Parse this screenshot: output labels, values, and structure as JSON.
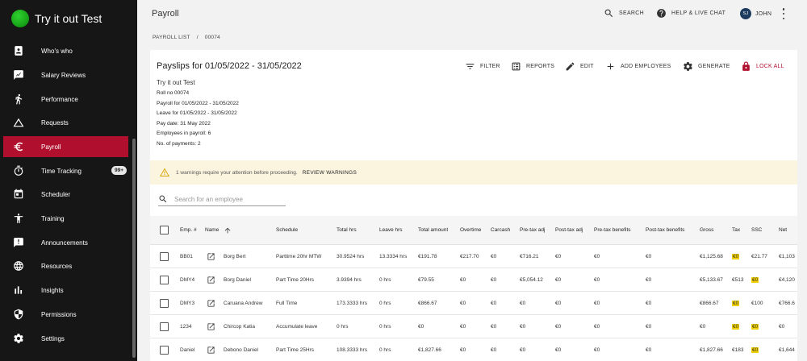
{
  "app": {
    "title": "Try it out Test"
  },
  "sidebar": {
    "items": [
      {
        "label": "Who's who",
        "icon": "id-badge-icon"
      },
      {
        "label": "Salary Reviews",
        "icon": "chart-review-icon"
      },
      {
        "label": "Performance",
        "icon": "running-person-icon"
      },
      {
        "label": "Requests",
        "icon": "triangle-icon"
      },
      {
        "label": "Payroll",
        "icon": "euro-icon",
        "active": true
      },
      {
        "label": "Time Tracking",
        "icon": "stopwatch-icon",
        "badge": "99+"
      },
      {
        "label": "Scheduler",
        "icon": "calendar-icon"
      },
      {
        "label": "Training",
        "icon": "person-arms-icon"
      },
      {
        "label": "Announcements",
        "icon": "announcement-icon"
      },
      {
        "label": "Resources",
        "icon": "globe-icon"
      },
      {
        "label": "Insights",
        "icon": "bar-chart-icon"
      },
      {
        "label": "Permissions",
        "icon": "shield-icon"
      },
      {
        "label": "Settings",
        "icon": "gear-icon"
      }
    ]
  },
  "header": {
    "title": "Payroll",
    "search_label": "SEARCH",
    "help_label": "HELP & LIVE CHAT",
    "user_initials": "SJ",
    "user_name": "JOHN"
  },
  "breadcrumb": {
    "root": "PAYROLL LIST",
    "separator": "/",
    "current": "00074"
  },
  "payslips": {
    "title": "Payslips for 01/05/2022 - 31/05/2022",
    "actions": {
      "filter": "FILTER",
      "reports": "REPORTS",
      "edit": "EDIT",
      "add_employees": "ADD EMPLOYEES",
      "generate": "GENERATE",
      "lock_all": "LOCK ALL"
    },
    "info": {
      "company": "Try it out Test",
      "lines": [
        "Roll no 00074",
        "Payroll for 01/05/2022 - 31/05/2022",
        "Leave for 01/05/2022 - 31/05/2022",
        "Pay date: 31 May 2022",
        "Employees in payroll: 6",
        "No. of payments: 2"
      ]
    },
    "warning": {
      "text": "1 warnings require your attention before proceeding.",
      "link": "REVIEW WARNINGS"
    },
    "search_placeholder": "Search for an employee"
  },
  "table": {
    "columns": [
      "Emp. #",
      "Name",
      "Schedule",
      "Total hrs",
      "Leave hrs",
      "Total amount",
      "Overtime",
      "Carcash",
      "Pre-tax adj",
      "Post-tax adj",
      "Pre-tax benefits",
      "Post-tax benefits",
      "Gross",
      "Tax",
      "SSC",
      "Net"
    ],
    "rows": [
      {
        "emp": "BB01",
        "name": "Borg Bert",
        "schedule": "Parttime 20hr MTW",
        "total_hrs": "30.9524 hrs",
        "leave_hrs": "13.3334 hrs",
        "total_amount": "€191.78",
        "overtime": "€217.70",
        "carcash": "€0",
        "pre_tax_adj": "€716.21",
        "post_tax_adj": "€0",
        "pre_tax_benefits": "€0",
        "post_tax_benefits": "€0",
        "gross": "€1,125.68",
        "tax": "€0",
        "tax_hl": true,
        "ssc": "€21.77",
        "ssc_hl": false,
        "net": "€1,103"
      },
      {
        "emp": "DMY4",
        "name": "Borg Daniel",
        "schedule": "Part Time 20Hrs",
        "total_hrs": "3.9394 hrs",
        "leave_hrs": "0 hrs",
        "total_amount": "€79.55",
        "overtime": "€0",
        "carcash": "€0",
        "pre_tax_adj": "€5,054.12",
        "post_tax_adj": "€0",
        "pre_tax_benefits": "€0",
        "post_tax_benefits": "€0",
        "gross": "€5,133.67",
        "tax": "€513",
        "tax_hl": false,
        "ssc": "€0",
        "ssc_hl": true,
        "net": "€4,120"
      },
      {
        "emp": "DMY3",
        "name": "Caruana Andrew",
        "schedule": "Full Time",
        "total_hrs": "173.3333 hrs",
        "leave_hrs": "0 hrs",
        "total_amount": "€866.67",
        "overtime": "€0",
        "carcash": "€0",
        "pre_tax_adj": "€0",
        "post_tax_adj": "€0",
        "pre_tax_benefits": "€0",
        "post_tax_benefits": "€0",
        "gross": "€866.67",
        "tax": "€0",
        "tax_hl": true,
        "ssc": "€100",
        "ssc_hl": false,
        "net": "€766.6"
      },
      {
        "emp": "1234",
        "name": "Chircop Katia",
        "schedule": "Accumulate leave",
        "total_hrs": "0 hrs",
        "leave_hrs": "0 hrs",
        "total_amount": "€0",
        "overtime": "€0",
        "carcash": "€0",
        "pre_tax_adj": "€0",
        "post_tax_adj": "€0",
        "pre_tax_benefits": "€0",
        "post_tax_benefits": "€0",
        "gross": "€0",
        "tax": "€0",
        "tax_hl": true,
        "ssc": "€0",
        "ssc_hl": true,
        "net": "€0"
      },
      {
        "emp": "Daniel",
        "name": "Debono Daniel",
        "schedule": "Part Time 25Hrs",
        "total_hrs": "108.3333 hrs",
        "leave_hrs": "0 hrs",
        "total_amount": "€1,827.66",
        "overtime": "€0",
        "carcash": "€0",
        "pre_tax_adj": "€0",
        "post_tax_adj": "€0",
        "pre_tax_benefits": "€0",
        "post_tax_benefits": "€0",
        "gross": "€1,827.66",
        "tax": "€183",
        "tax_hl": false,
        "ssc": "€0",
        "ssc_hl": true,
        "net": "€1,644"
      }
    ]
  },
  "colors": {
    "accent": "#b0102d",
    "sidebar_bg": "#161616",
    "warning_bg": "#fbf4df",
    "highlight": "#f0d000"
  }
}
